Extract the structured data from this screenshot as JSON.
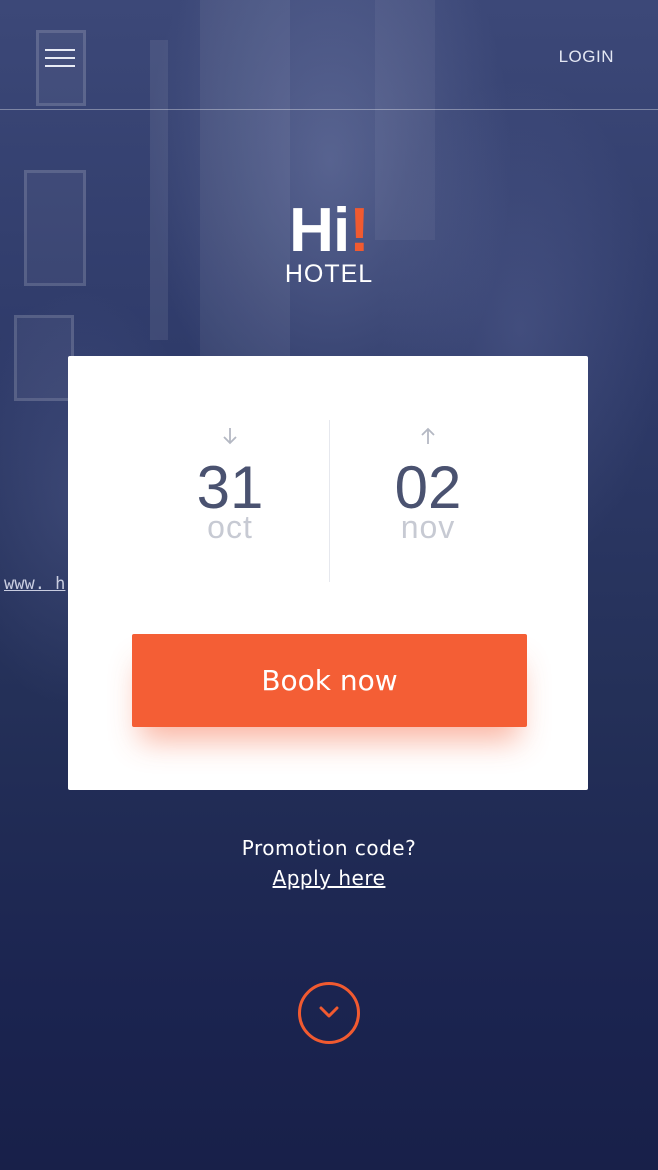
{
  "header": {
    "menu_icon": "hamburger-menu-icon",
    "login_label": "LOGIN"
  },
  "logo": {
    "mark": "Hi",
    "exclamation": "!",
    "subtitle": "HOTEL"
  },
  "booking": {
    "checkin": {
      "arrow_icon": "arrow-down-icon",
      "day": "31",
      "month": "oct"
    },
    "checkout": {
      "arrow_icon": "arrow-up-icon",
      "day": "02",
      "month": "nov"
    },
    "book_label": "Book now"
  },
  "watermark": {
    "text": "www. h"
  },
  "promo": {
    "question": "Promotion code?",
    "link_label": "Apply here"
  },
  "scroll": {
    "icon": "chevron-down-icon"
  },
  "colors": {
    "accent": "#f45e35",
    "background": "#243058",
    "date_number": "#4a5270",
    "month_text": "#c7cad3"
  }
}
